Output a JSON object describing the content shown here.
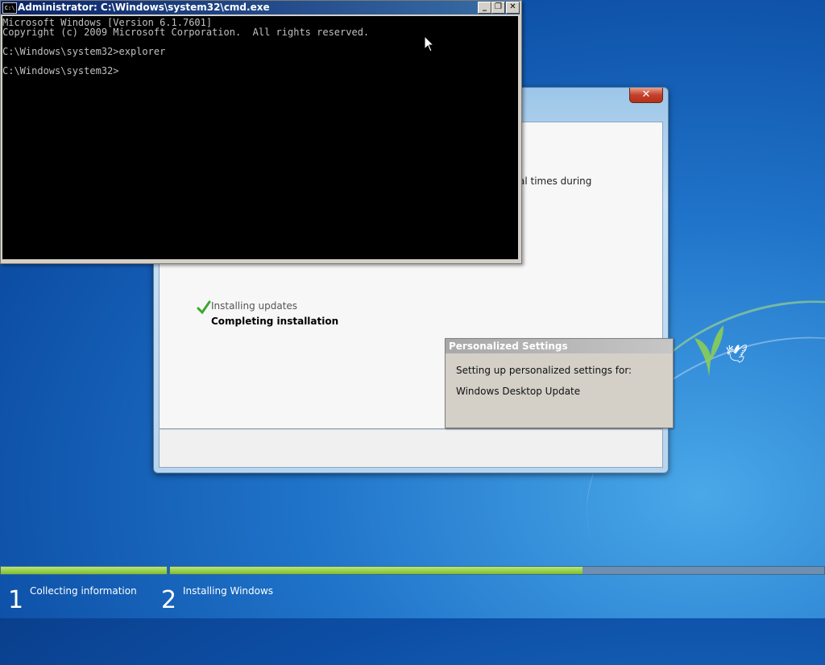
{
  "cmd": {
    "title": "Administrator: C:\\Windows\\system32\\cmd.exe",
    "icon_text": "C:\\",
    "lines": [
      "Microsoft Windows [Version 6.1.7601]",
      "Copyright (c) 2009 Microsoft Corporation.  All rights reserved.",
      "",
      "C:\\Windows\\system32>explorer",
      "",
      "C:\\Windows\\system32>"
    ],
    "buttons": {
      "minimize": "_",
      "restore": "❐",
      "close": "✕"
    }
  },
  "setup": {
    "close_label": "✕",
    "partial_text": "al times during",
    "steps": [
      {
        "label": "Installing updates",
        "done": true
      },
      {
        "label": "Completing installation",
        "current": true
      }
    ]
  },
  "dialog": {
    "title": "Personalized Settings",
    "line1": "Setting up personalized settings for:",
    "line2": "Windows Desktop Update"
  },
  "progress": {
    "stage1": {
      "number": "1",
      "label": "Collecting information",
      "fill": 1.0
    },
    "stage2": {
      "number": "2",
      "label": "Installing Windows",
      "fill": 0.63
    }
  },
  "colors": {
    "progress_fill": "#8cc63f",
    "cmd_title": "#0a246a"
  }
}
